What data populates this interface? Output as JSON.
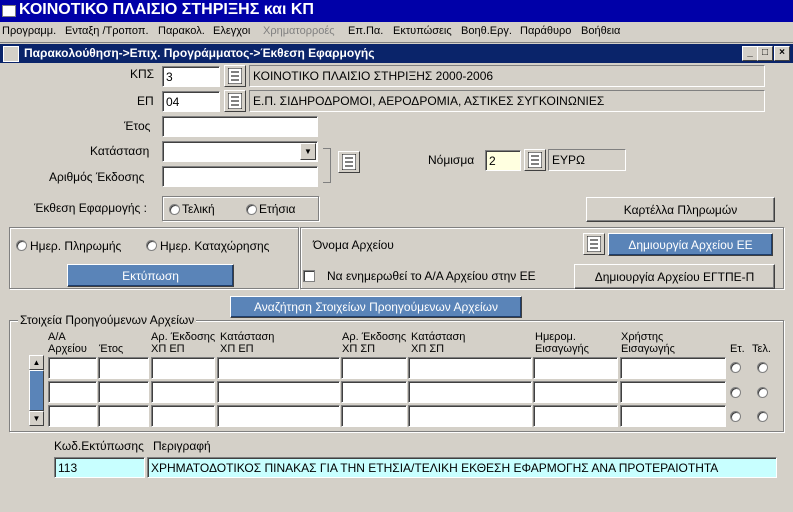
{
  "app": {
    "title": "ΚΟΙΝΟΤΙΚΟ ΠΛΑΙΣΙΟ ΣΤΗΡΙΞΗΣ και ΚΠ"
  },
  "menu": [
    "Προγραμμ.",
    "Ενταξη /Τροποπ.",
    "Παρακολ.",
    "Ελεγχοι",
    "Χρηματορροές",
    "Επ.Πα.",
    "Εκτυπώσεις",
    "Βοηθ.Εργ.",
    "Παράθυρο",
    "Βοήθεια"
  ],
  "window": {
    "title": "Παρακολούθηση->Επιχ. Προγράμματος->Έκθεση Εφαρμογής"
  },
  "form": {
    "kps_label": "ΚΠΣ",
    "kps_code": "3",
    "kps_desc": "ΚΟΙΝΟΤΙΚΟ ΠΛΑΙΣΙΟ ΣΤΗΡΙΞΗΣ 2000-2006",
    "ep_label": "ΕΠ",
    "ep_code": "04",
    "ep_desc": "Ε.Π. ΣΙΔΗΡΟΔΡΟΜΟΙ, ΑΕΡΟΔΡΟΜΙΑ, ΑΣΤΙΚΕΣ ΣΥΓΚΟΙΝΩΝΙΕΣ",
    "year_label": "Έτος",
    "year_value": "",
    "status_label": "Κατάσταση",
    "status_value": "",
    "issue_label": "Αριθμός Έκδοσης",
    "issue_value": "",
    "currency_label": "Νόμισμα",
    "currency_code": "2",
    "currency_desc": "ΕΥΡΩ",
    "report_type_label": "Έκθεση Εφαρμογής :",
    "report_final": "Τελική",
    "report_annual": "Ετήσια",
    "payments_card_button": "Καρτέλλα Πληρωμών"
  },
  "print_panel": {
    "payment_date": "Ημερ. Πληρωμής",
    "register_date": "Ημερ. Καταχώρησης",
    "print_button": "Εκτύπωση"
  },
  "file_panel": {
    "filename_label": "Όνομα Αρχείου",
    "create_ee_button": "Δημιουργία Αρχείου ΕΕ",
    "update_label": "Να ενημερωθεί το Α/Α Αρχείου στην ΕΕ",
    "create_egtpe_button": "Δημιουργία Αρχείου ΕΓΤΠΕ-Π"
  },
  "search_button": "Αναζήτηση Στοιχείων Προηγούμενων Αρχείων",
  "previous_files": {
    "title": "Στοιχεία Προηγούμενων Αρχείων",
    "columns": [
      "Α/Α\nΑρχείου",
      "Έτος",
      "Αρ. Έκδοσης\nΧΠ ΕΠ",
      "Κατάσταση\nΧΠ ΕΠ",
      "Αρ. Έκδοσης\nΧΠ ΣΠ",
      "Κατάσταση\nΧΠ ΣΠ",
      "Ημερομ.\nΕισαγωγής",
      "Χρήστης\nΕισαγωγής",
      "Ετ.",
      "Τελ."
    ],
    "row_count": 3
  },
  "footer": {
    "code_label": "Κωδ.Εκτύπωσης",
    "desc_label": "Περιγραφή",
    "code_value": "113",
    "desc_value": "ΧΡΗΜΑΤΟΔΟΤΙΚΟΣ ΠΙΝΑΚΑΣ ΓΙΑ ΤΗΝ ΕΤΗΣΙΑ/ΤΕΛΙΚΗ ΕΚΘΕΣΗ ΕΦΑΡΜΟΓΗΣ ΑΝΑ ΠΡΟΤΕΡΑΙΟΤΗΤΑ"
  },
  "colors": {
    "titlebar": "#0000a8",
    "window_title": "#0a246a",
    "button_blue": "#5a84b8",
    "cyan_field": "#c8ffff",
    "face": "#d4d0c8"
  }
}
